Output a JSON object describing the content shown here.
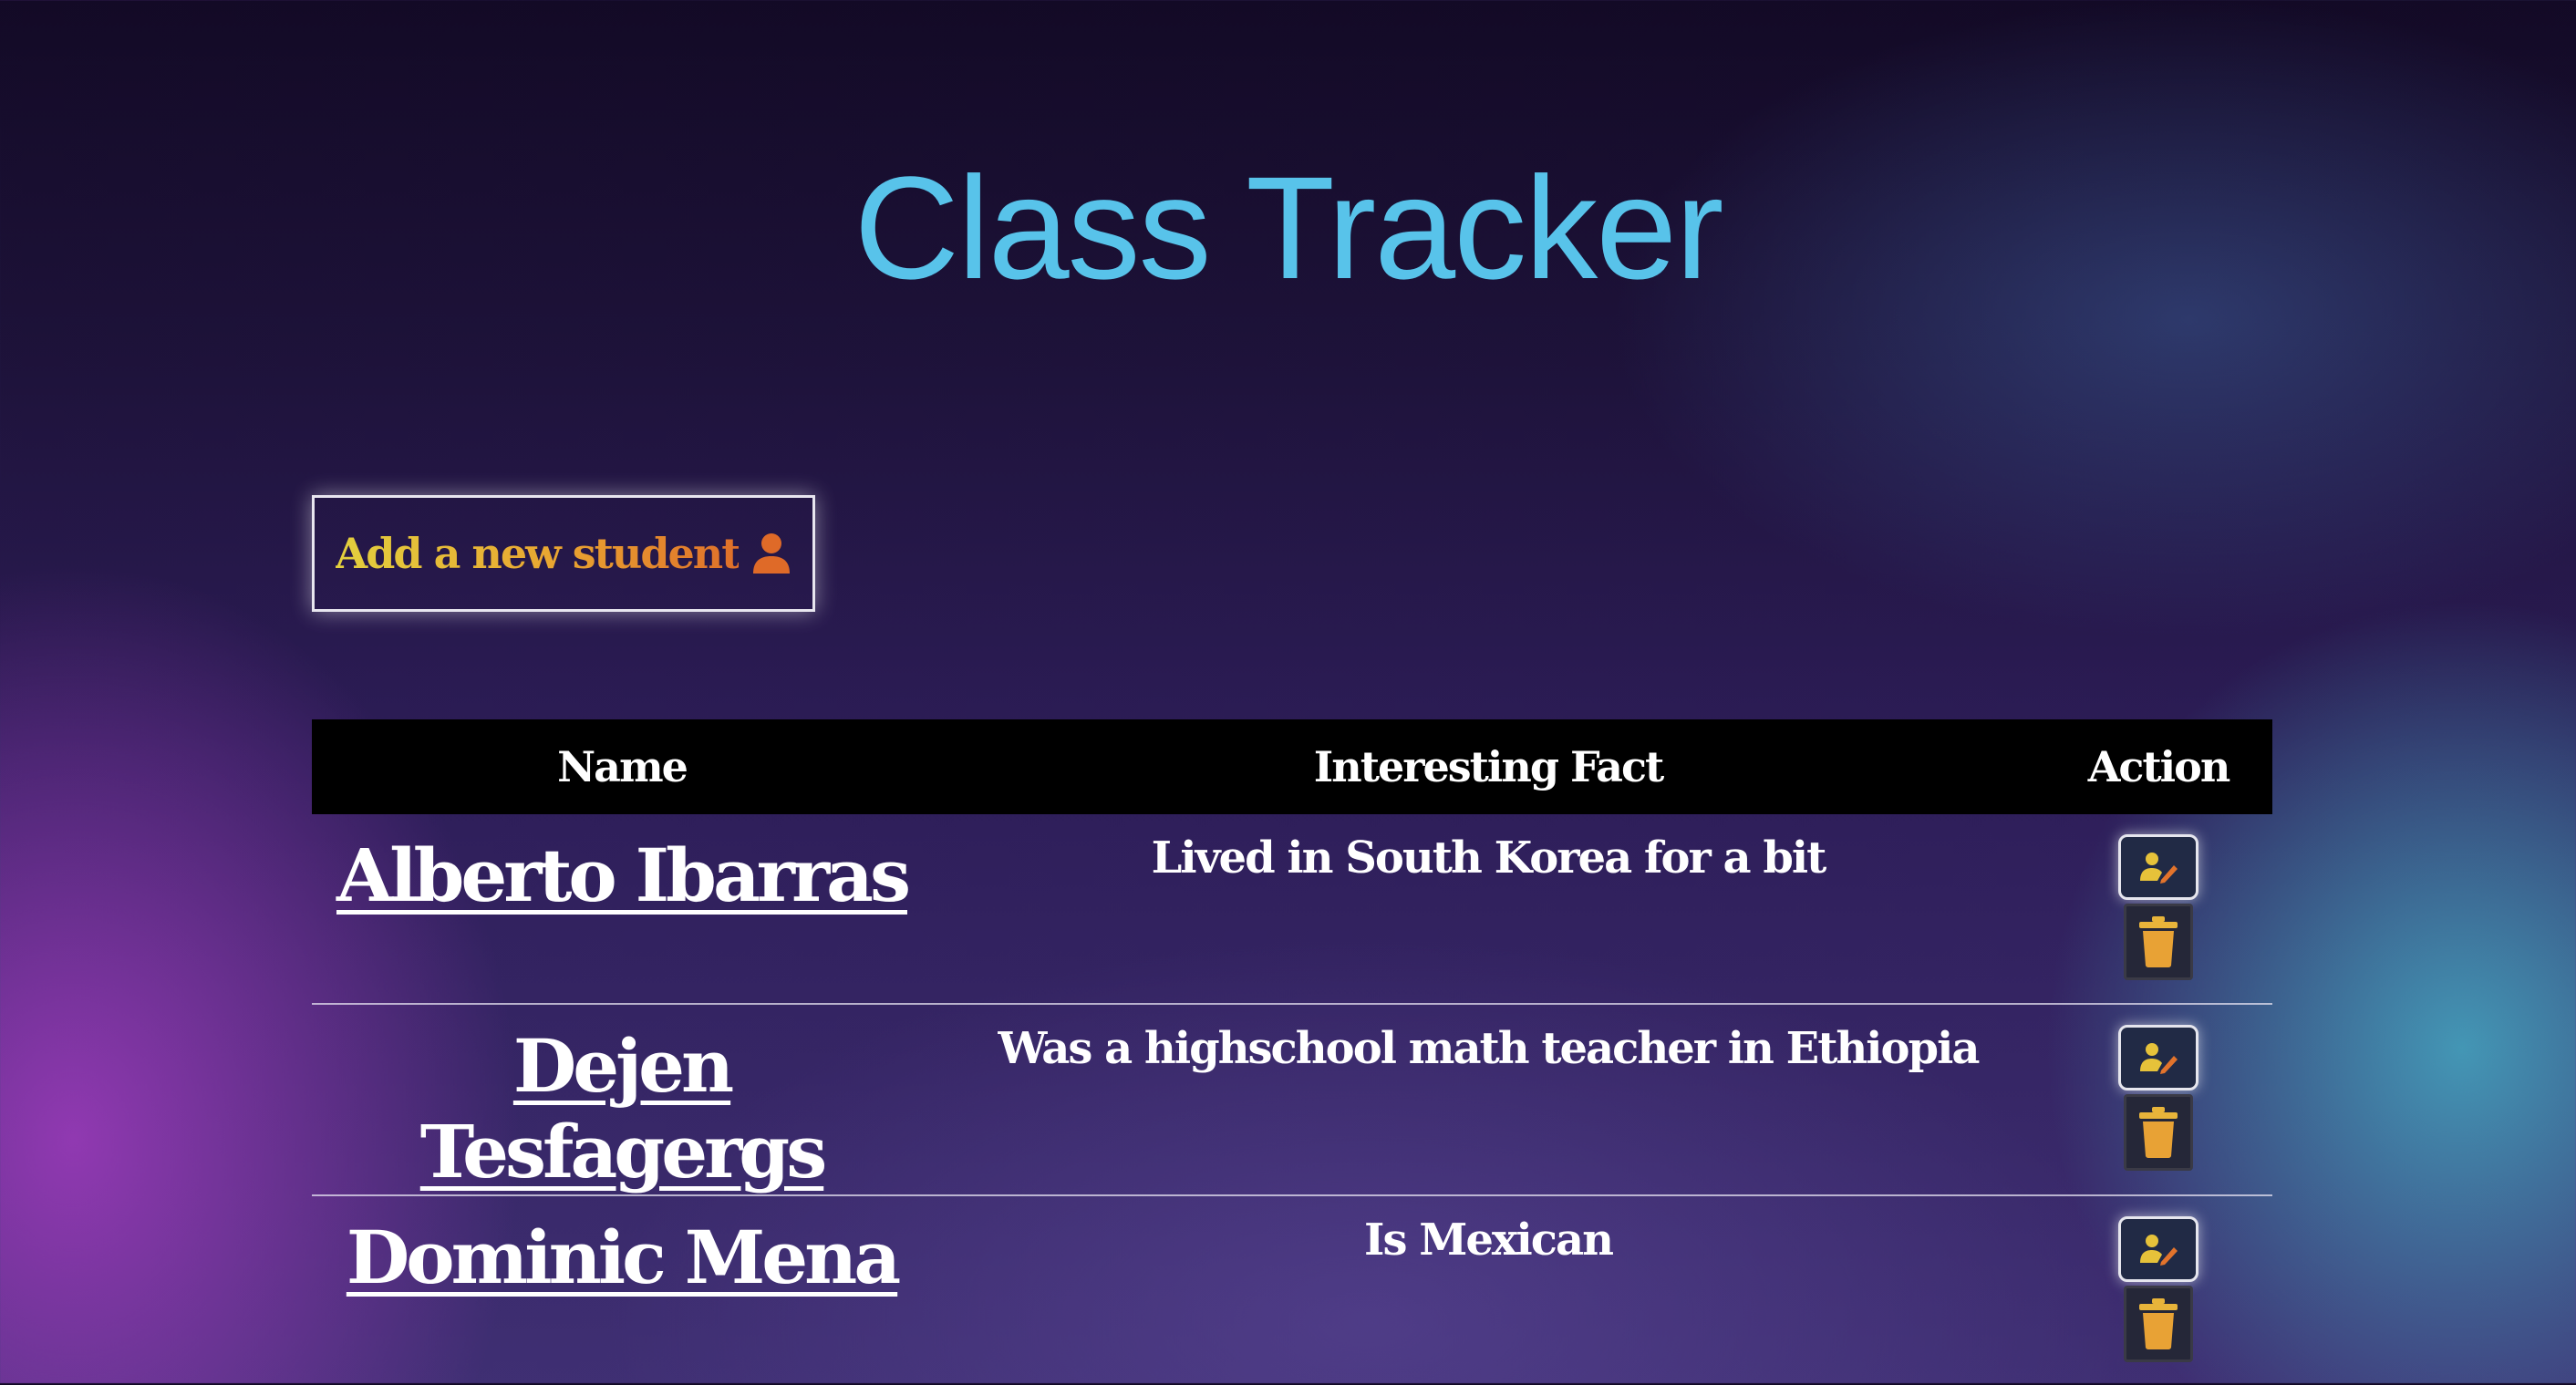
{
  "header": {
    "title": "Class Tracker"
  },
  "add_button": {
    "label": "Add a new student",
    "icon": "person-icon"
  },
  "table": {
    "columns": [
      "Name",
      "Interesting Fact",
      "Action"
    ],
    "rows": [
      {
        "name": "Alberto Ibarras",
        "fact": "Lived in South Korea for a bit"
      },
      {
        "name": "Dejen Tesfagergs",
        "fact": "Was a highschool math teacher in Ethiopia"
      },
      {
        "name": "Dominic Mena",
        "fact": "Is Mexican"
      }
    ],
    "action_icons": [
      "edit-user-icon",
      "trash-icon"
    ]
  },
  "colors": {
    "title": "#58c3ea",
    "accent_yellow": "#e3d03e",
    "accent_orange": "#df6f2a",
    "header_row": "#000000"
  }
}
